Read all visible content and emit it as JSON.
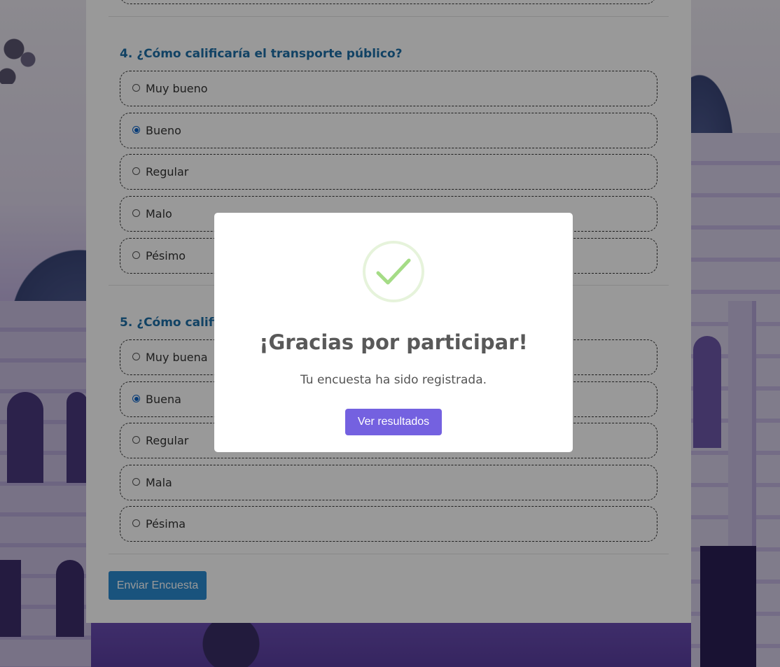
{
  "survey": {
    "questions": [
      {
        "title": "4. ¿Cómo calificaría el transporte público?",
        "options": [
          {
            "label": "Muy bueno",
            "checked": false
          },
          {
            "label": "Bueno",
            "checked": true
          },
          {
            "label": "Regular",
            "checked": false
          },
          {
            "label": "Malo",
            "checked": false
          },
          {
            "label": "Pésimo",
            "checked": false
          }
        ]
      },
      {
        "title": "5. ¿Cómo califi",
        "options": [
          {
            "label": "Muy buena",
            "checked": false
          },
          {
            "label": "Buena",
            "checked": true
          },
          {
            "label": "Regular",
            "checked": false
          },
          {
            "label": "Mala",
            "checked": false
          },
          {
            "label": "Pésima",
            "checked": false
          }
        ]
      }
    ],
    "submit_label": "Enviar Encuesta"
  },
  "modal": {
    "icon": "success-check-icon",
    "title": "¡Gracias por participar!",
    "message": "Tu encuesta ha sido registrada.",
    "button_label": "Ver resultados"
  },
  "colors": {
    "question_title": "#1d6fa7",
    "submit_button": "#2a8bd1",
    "modal_button": "#7461e0",
    "radio_checked": "#0a63c9",
    "success_check": "#a5dc86"
  }
}
